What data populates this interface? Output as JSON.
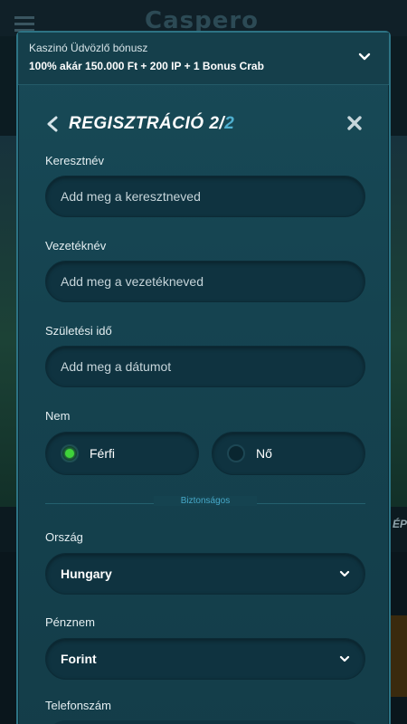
{
  "bonus": {
    "title": "Kaszinó Üdvözlő bónusz",
    "text": "100% akár 150.000 Ft + 200 IP + 1 Bonus Crab"
  },
  "header": {
    "title_main": "REGISZTRÁCIÓ 2/",
    "title_total": "2"
  },
  "fields": {
    "first_name": {
      "label": "Keresztnév",
      "placeholder": "Add meg a keresztneved"
    },
    "last_name": {
      "label": "Vezetéknév",
      "placeholder": "Add meg a vezetékneved"
    },
    "birth_date": {
      "label": "Születési idő",
      "placeholder": "Add meg a dátumot"
    }
  },
  "gender": {
    "label": "Nem",
    "options": [
      {
        "label": "Férfi",
        "selected": true
      },
      {
        "label": "Nő",
        "selected": false
      }
    ]
  },
  "divider": {
    "text": "Biztonságos"
  },
  "country": {
    "label": "Ország",
    "value": "Hungary"
  },
  "currency": {
    "label": "Pénznem",
    "value": "Forint"
  },
  "phone": {
    "label": "Telefonszám"
  },
  "background": {
    "logo": "Caspero",
    "side_text": "ÉP"
  },
  "colors": {
    "accent": "#4fb0d0",
    "radio_selected": "#3fd23a",
    "modal_bg": "#154350"
  }
}
